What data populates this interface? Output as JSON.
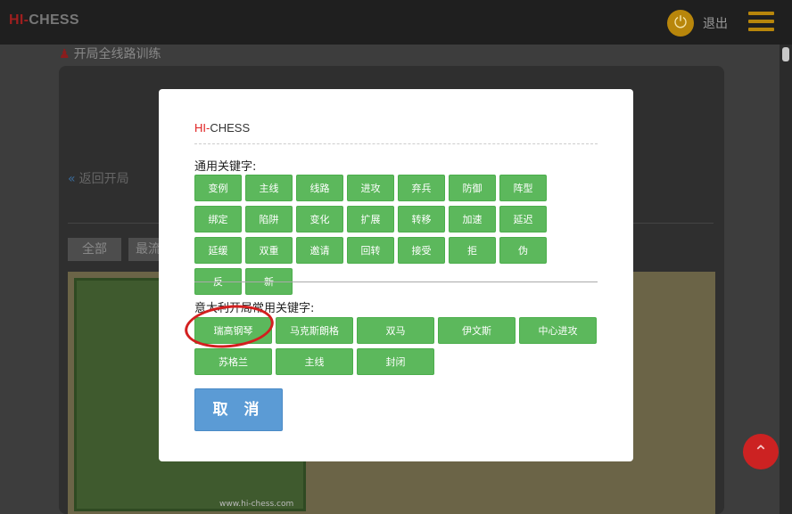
{
  "topbar": {
    "logo_prefix": "HI-",
    "logo_suffix": "CHESS",
    "logout_label": "退出"
  },
  "page": {
    "title": "开局全线路训练",
    "back_label": "返回开局",
    "filter_all": "全部",
    "filter_latest": "最流",
    "watermark": "www.hi-chess.com"
  },
  "modal": {
    "title_prefix": "HI-",
    "title_suffix": "CHESS",
    "general_label": "通用关键字:",
    "general_keywords": [
      "变例",
      "主线",
      "线路",
      "进攻",
      "弃兵",
      "防御",
      "阵型",
      "绑定",
      "陷阱",
      "变化",
      "扩展",
      "转移",
      "加速",
      "延迟",
      "延缓",
      "双重",
      "邀请",
      "回转",
      "接受",
      "拒",
      "伪",
      "反",
      "新"
    ],
    "italian_label": "意大利开局常用关键字:",
    "italian_keywords": [
      "瑞高钢琴",
      "马克斯朗格",
      "双马",
      "伊文斯",
      "中心进攻",
      "苏格兰",
      "主线",
      "封闭"
    ],
    "cancel_label": "取 消"
  },
  "colors": {
    "keyword_button": "#5cb85c",
    "cancel_button": "#5b9bd5",
    "highlight_circle": "#d31f1f",
    "accent_gold": "#b8860b"
  },
  "icons": {
    "power": "power-icon",
    "menu": "hamburger-menu-icon",
    "back": "double-chevron-left-icon",
    "to_top": "chevron-up-icon",
    "title": "chess-piece-icon"
  }
}
